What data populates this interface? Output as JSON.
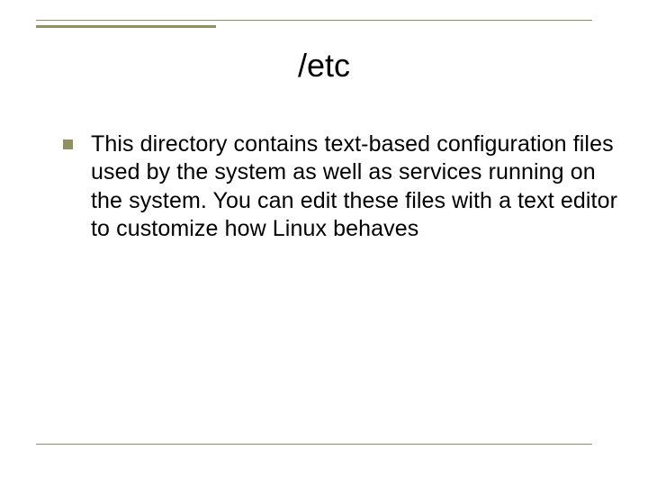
{
  "slide": {
    "title": "/etc",
    "bullets": [
      {
        "text": " This directory contains text-based configuration files used by the system as well as services running on the system. You can edit these files with a text editor to customize how Linux behaves"
      }
    ]
  }
}
